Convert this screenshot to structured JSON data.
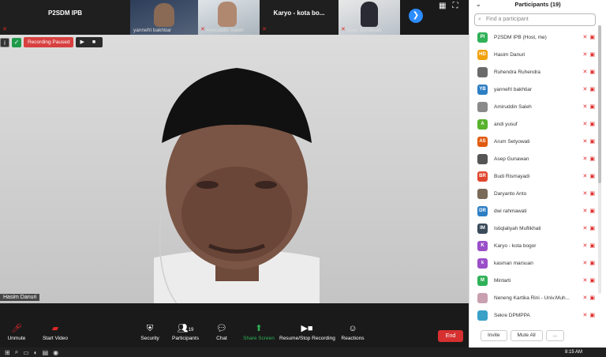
{
  "thumbnails": [
    {
      "label": "P2SDM IPB",
      "name": "",
      "muted": true,
      "type": "plain"
    },
    {
      "label": "",
      "name": "yannefri bakhtiar",
      "muted": false,
      "type": "video"
    },
    {
      "label": "",
      "name": "Amiruddin Saleh",
      "muted": true,
      "type": "video"
    },
    {
      "label": "Karyo - kota bo...",
      "name": "",
      "muted": true,
      "type": "plain"
    },
    {
      "label": "",
      "name": "Asep Gunawan",
      "muted": true,
      "type": "video"
    }
  ],
  "recording": {
    "status": "Recording Paused",
    "controls": "▶ ■"
  },
  "main": {
    "speaker": "Hasim Danuri"
  },
  "toolbar": {
    "unmute": "Unmute",
    "start_video": "Start Video",
    "security": "Security",
    "participants": "Participants",
    "participants_count": "19",
    "chat": "Chat",
    "share_screen": "Share Screen",
    "recording": "Resume/Stop Recording",
    "reactions": "Reactions",
    "end": "End"
  },
  "panel": {
    "title": "Participants (19)",
    "search_placeholder": "Find a participant",
    "invite": "Invite",
    "mute_all": "Mute All",
    "more": "..."
  },
  "participants": [
    {
      "initials": "PI",
      "name": "P2SDM IPB (Host, me)",
      "color": "#2fb158"
    },
    {
      "initials": "HD",
      "name": "Hasim Danuri",
      "color": "#f0a20e"
    },
    {
      "initials": "",
      "name": "Ruhendra Ruhendra",
      "color": "#6a6a6a"
    },
    {
      "initials": "YB",
      "name": "yannefri bakhtiar",
      "color": "#2d7fc4"
    },
    {
      "initials": "",
      "name": "Amiruddin Saleh",
      "color": "#8a8a8a"
    },
    {
      "initials": "A",
      "name": "andi yusuf",
      "color": "#57b22c"
    },
    {
      "initials": "AS",
      "name": "Arum Setyowati",
      "color": "#e05b0e"
    },
    {
      "initials": "",
      "name": "Asep Gunawan",
      "color": "#555555"
    },
    {
      "initials": "BR",
      "name": "Budi Rismayadi",
      "color": "#e0472f"
    },
    {
      "initials": "",
      "name": "Daryanto Anto",
      "color": "#7a6a5a"
    },
    {
      "initials": "DR",
      "name": "dwi rahmawati",
      "color": "#2d7fc4"
    },
    {
      "initials": "IM",
      "name": "Istiqlaliyah Muflikhati",
      "color": "#3a4a5a"
    },
    {
      "initials": "K",
      "name": "Karyo - kota bogor",
      "color": "#9a4fc9"
    },
    {
      "initials": "k",
      "name": "kasman marsuan",
      "color": "#9a4fc9"
    },
    {
      "initials": "M",
      "name": "Mintarti",
      "color": "#2fb158"
    },
    {
      "initials": "",
      "name": "Neneng Kartika Rini - Univ.Muh...",
      "color": "#c9a0b0"
    },
    {
      "initials": "",
      "name": "Sekre DPMPPA",
      "color": "#3aa0c8"
    }
  ],
  "taskbar": {
    "time": "8:15 AM"
  }
}
